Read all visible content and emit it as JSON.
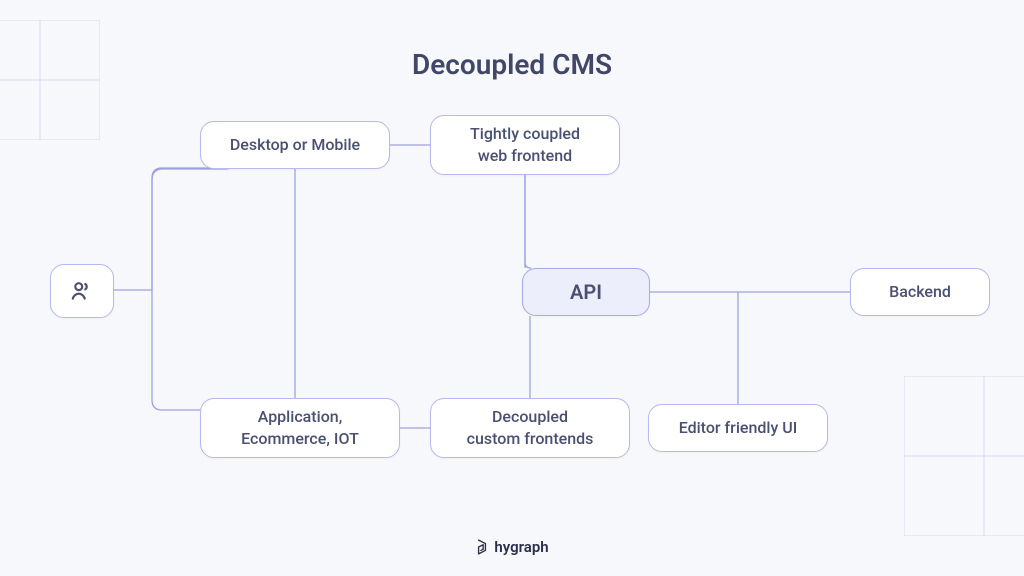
{
  "title": "Decoupled CMS",
  "nodes": {
    "user": "user",
    "desktop_mobile": "Desktop or Mobile",
    "tightly_coupled": "Tightly coupled\nweb frontend",
    "application": "Application,\nEcommerce, IOT",
    "decoupled_frontends": "Decoupled\ncustom frontends",
    "api": "API",
    "editor_ui": "Editor friendly UI",
    "backend": "Backend"
  },
  "brand": "hygraph",
  "colors": {
    "bg": "#f7f8fc",
    "node_border": "#b7b8ee",
    "node_bg": "#ffffff",
    "api_bg": "#eceefc",
    "text": "#4a5072",
    "connector": "#9ea1dc",
    "deco": "#d8daf2"
  }
}
